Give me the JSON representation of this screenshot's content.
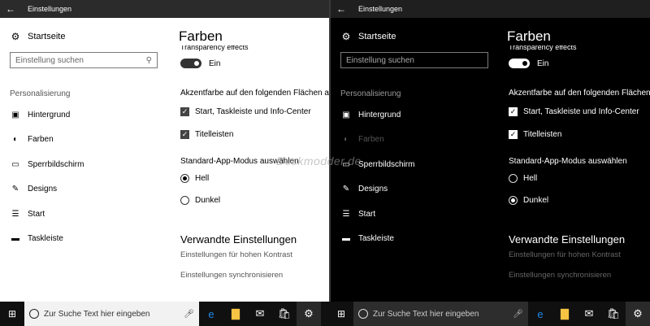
{
  "app": {
    "title": "Einstellungen",
    "back_glyph": "←"
  },
  "sidebar": {
    "home_label": "Startseite",
    "search_placeholder": "Einstellung suchen",
    "group_label": "Personalisierung",
    "items": [
      {
        "label": "Hintergrund",
        "icon": "image-icon"
      },
      {
        "label": "Farben",
        "icon": "palette-icon"
      },
      {
        "label": "Sperrbildschirm",
        "icon": "lockscreen-icon"
      },
      {
        "label": "Designs",
        "icon": "brush-icon"
      },
      {
        "label": "Start",
        "icon": "start-icon"
      },
      {
        "label": "Taskleiste",
        "icon": "taskbar-icon"
      }
    ]
  },
  "main": {
    "title": "Farben",
    "transparency_label": "Transparency effects",
    "toggle_state_label": "Ein",
    "accent_heading": "Akzentfarbe auf den folgenden Flächen anzeigen",
    "checkboxes": [
      {
        "label": "Start, Taskleiste und Info-Center",
        "checked": true
      },
      {
        "label": "Titelleisten",
        "checked": true
      }
    ],
    "app_mode_heading": "Standard-App-Modus auswählen",
    "radios": [
      {
        "label": "Hell"
      },
      {
        "label": "Dunkel"
      }
    ],
    "related_heading": "Verwandte Einstellungen",
    "related_links": [
      "Einstellungen für hohen Kontrast",
      "Einstellungen synchronisieren"
    ]
  },
  "panels": {
    "light": {
      "selected_mode": "Hell"
    },
    "dark": {
      "selected_mode": "Dunkel"
    }
  },
  "watermark": "Deskmodder.de",
  "taskbar": {
    "search_placeholder": "Zur Suche Text hier eingeben",
    "icons": [
      "windows-icon",
      "microphone-icon",
      "edge-icon",
      "explorer-icon",
      "mail-icon",
      "store-icon",
      "settings-icon"
    ]
  },
  "colors": {
    "light_bg": "#ffffff",
    "dark_bg": "#000000",
    "taskbar_bg": "#101010",
    "edge_blue": "#1e88e5",
    "explorer_yellow": "#f6c343"
  }
}
